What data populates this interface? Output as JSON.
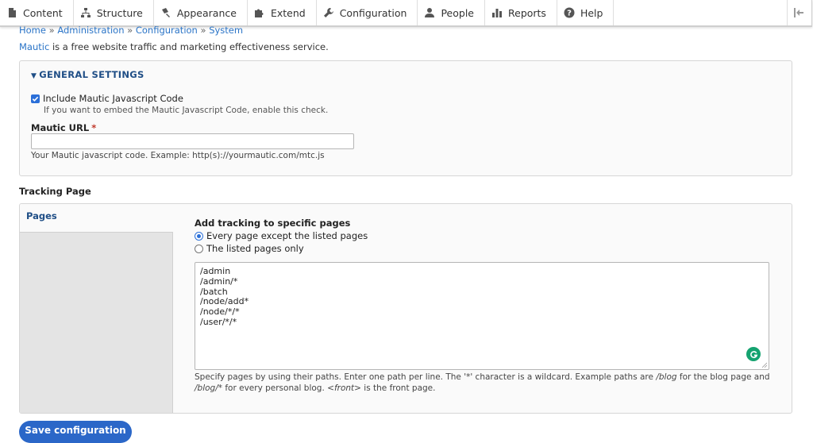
{
  "toolbar": {
    "items": [
      {
        "label": "Content",
        "icon": "document-icon"
      },
      {
        "label": "Structure",
        "icon": "structure-icon"
      },
      {
        "label": "Appearance",
        "icon": "paint-icon"
      },
      {
        "label": "Extend",
        "icon": "puzzle-icon"
      },
      {
        "label": "Configuration",
        "icon": "wrench-icon"
      },
      {
        "label": "People",
        "icon": "person-icon"
      },
      {
        "label": "Reports",
        "icon": "bar-chart-icon"
      },
      {
        "label": "Help",
        "icon": "help-icon"
      }
    ],
    "collapse_icon": "collapse-icon"
  },
  "breadcrumb": {
    "items": [
      "Home",
      "Administration",
      "Configuration",
      "System"
    ],
    "separator": "»"
  },
  "intro": {
    "link": "Mautic",
    "text": " is a free website traffic and marketing effectiveness service."
  },
  "general": {
    "summary": "GENERAL SETTINGS",
    "checkbox_label": "Include Mautic Javascript Code",
    "checkbox_checked": true,
    "checkbox_description": "If you want to embed the Mautic Javascript Code, enable this check.",
    "url_label": "Mautic URL",
    "url_required_mark": "*",
    "url_value": "",
    "url_description": "Your Mautic javascript code. Example: http(s)://yourmautic.com/mtc.js"
  },
  "tracking": {
    "title": "Tracking Page",
    "tab_label": "Pages",
    "pane_title": "Add tracking to specific pages",
    "options": [
      {
        "label": "Every page except the listed pages",
        "selected": true
      },
      {
        "label": "The listed pages only",
        "selected": false
      }
    ],
    "pages": [
      "/admin",
      "/admin/*",
      "/batch",
      "/node/add*",
      "/node/*/*",
      "/user/*/*"
    ],
    "help_parts": [
      "Specify pages by using their paths. Enter one path per line. The '*' character is a wildcard. Example paths are ",
      "/blog",
      " for the blog page and ",
      "/blog/*",
      " for every personal blog. ",
      "<front>",
      " is the front page."
    ]
  },
  "save_label": "Save configuration",
  "colors": {
    "accent": "#2b67c8",
    "link": "#2a74c7",
    "summary": "#1f4e86",
    "required": "#c0392b",
    "grammarly": "#15a370"
  }
}
